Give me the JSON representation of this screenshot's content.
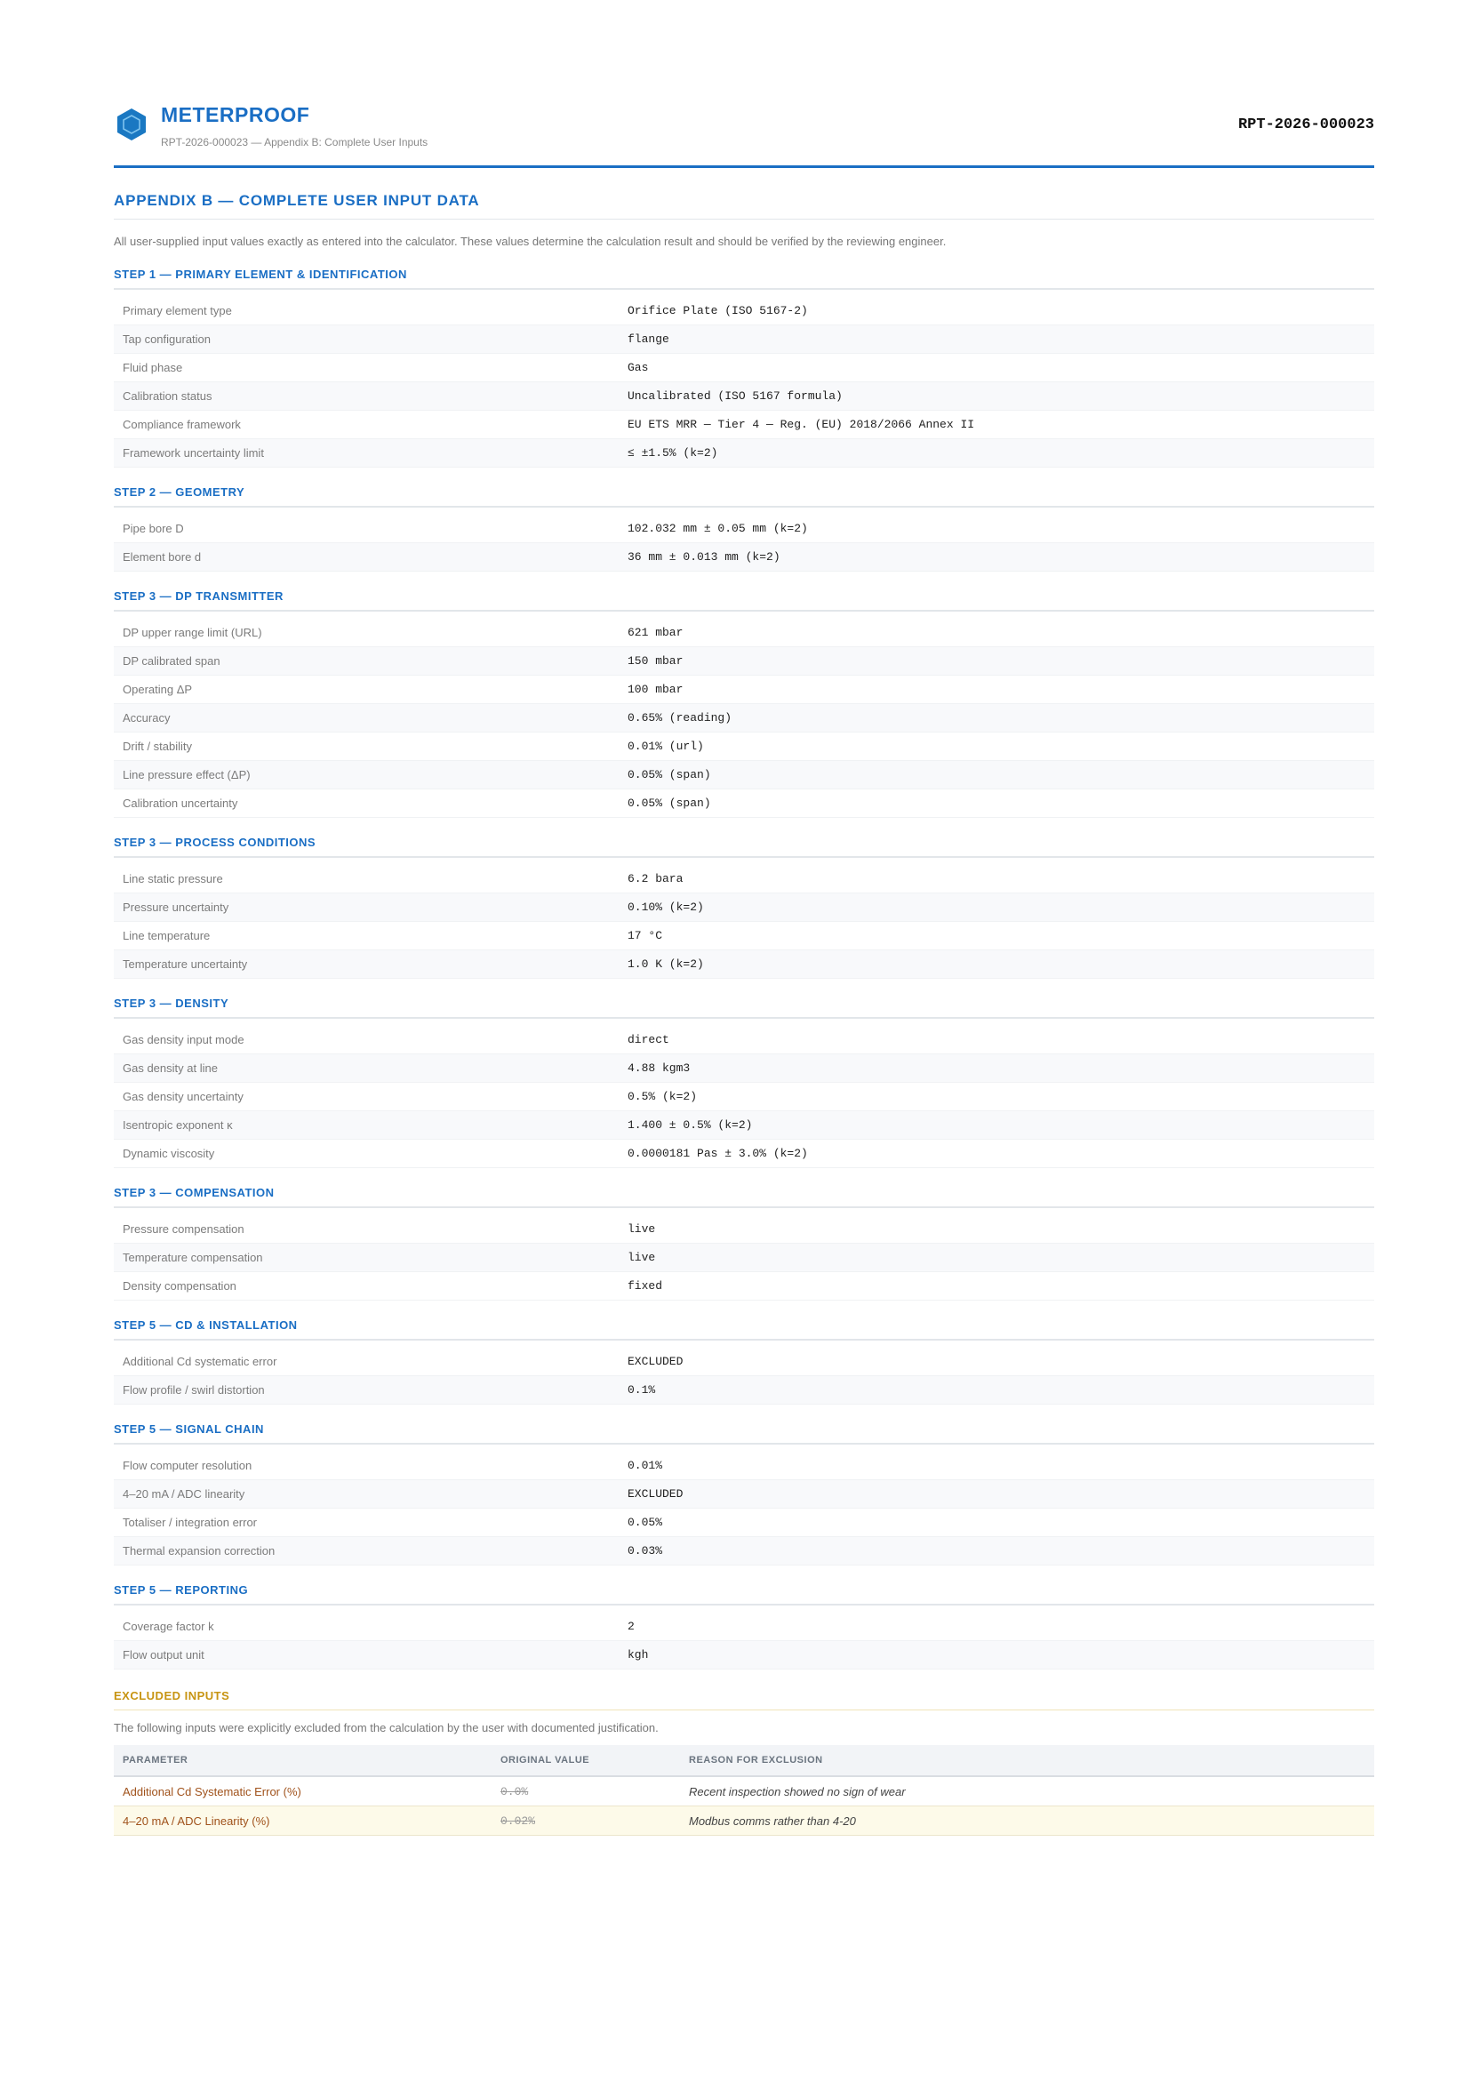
{
  "header": {
    "brand": "METERPROOF",
    "subtitle": "RPT-2026-000023 — Appendix B: Complete User Inputs",
    "report_id": "RPT-2026-000023",
    "accent_color": "#1a6ec4",
    "logo_icon": "hexagon-logo-icon"
  },
  "appendix": {
    "title": "APPENDIX B — COMPLETE USER INPUT DATA",
    "intro": "All user-supplied input values exactly as entered into the calculator. These values determine the calculation result and should be verified by the reviewing engineer."
  },
  "sections": [
    {
      "title": "STEP 1 — PRIMARY ELEMENT & IDENTIFICATION",
      "rows": [
        {
          "label": "Primary element type",
          "value": "Orifice Plate (ISO 5167-2)"
        },
        {
          "label": "Tap configuration",
          "value": "flange"
        },
        {
          "label": "Fluid phase",
          "value": "Gas"
        },
        {
          "label": "Calibration status",
          "value": "Uncalibrated (ISO 5167 formula)"
        },
        {
          "label": "Compliance framework",
          "value": "EU ETS MRR — Tier 4 — Reg. (EU) 2018/2066 Annex II"
        },
        {
          "label": "Framework uncertainty limit",
          "value": "≤ ±1.5% (k=2)"
        }
      ]
    },
    {
      "title": "STEP 2 — GEOMETRY",
      "rows": [
        {
          "label": "Pipe bore D",
          "value": "102.032 mm ± 0.05 mm (k=2)"
        },
        {
          "label": "Element bore d",
          "value": "36 mm ± 0.013 mm (k=2)"
        }
      ]
    },
    {
      "title": "STEP 3 — DP TRANSMITTER",
      "rows": [
        {
          "label": "DP upper range limit (URL)",
          "value": "621 mbar"
        },
        {
          "label": "DP calibrated span",
          "value": "150 mbar"
        },
        {
          "label": "Operating ΔP",
          "value": "100 mbar"
        },
        {
          "label": "Accuracy",
          "value": "0.65% (reading)"
        },
        {
          "label": "Drift / stability",
          "value": "0.01% (url)"
        },
        {
          "label": "Line pressure effect (ΔP)",
          "value": "0.05% (span)"
        },
        {
          "label": "Calibration uncertainty",
          "value": "0.05% (span)"
        }
      ]
    },
    {
      "title": "STEP 3 — PROCESS CONDITIONS",
      "rows": [
        {
          "label": "Line static pressure",
          "value": "6.2 bara"
        },
        {
          "label": "Pressure uncertainty",
          "value": "0.10% (k=2)"
        },
        {
          "label": "Line temperature",
          "value": "17 °C"
        },
        {
          "label": "Temperature uncertainty",
          "value": "1.0 K (k=2)"
        }
      ]
    },
    {
      "title": "STEP 3 — DENSITY",
      "rows": [
        {
          "label": "Gas density input mode",
          "value": "direct"
        },
        {
          "label": "Gas density at line",
          "value": "4.88 kgm3"
        },
        {
          "label": "Gas density uncertainty",
          "value": "0.5% (k=2)"
        },
        {
          "label": "Isentropic exponent κ",
          "value": "1.400 ± 0.5% (k=2)"
        },
        {
          "label": "Dynamic viscosity",
          "value": "0.0000181 Pas ± 3.0% (k=2)"
        }
      ]
    },
    {
      "title": "STEP 3 — COMPENSATION",
      "rows": [
        {
          "label": "Pressure compensation",
          "value": "live"
        },
        {
          "label": "Temperature compensation",
          "value": "live"
        },
        {
          "label": "Density compensation",
          "value": "fixed"
        }
      ]
    },
    {
      "title": "STEP 5 — CD & INSTALLATION",
      "rows": [
        {
          "label": "Additional Cd systematic error",
          "value": "EXCLUDED"
        },
        {
          "label": "Flow profile / swirl distortion",
          "value": "0.1%"
        }
      ]
    },
    {
      "title": "STEP 5 — SIGNAL CHAIN",
      "rows": [
        {
          "label": "Flow computer resolution",
          "value": "0.01%"
        },
        {
          "label": "4–20 mA / ADC linearity",
          "value": "EXCLUDED"
        },
        {
          "label": "Totaliser / integration error",
          "value": "0.05%"
        },
        {
          "label": "Thermal expansion correction",
          "value": "0.03%"
        }
      ]
    },
    {
      "title": "STEP 5 — REPORTING",
      "rows": [
        {
          "label": "Coverage factor k",
          "value": "2"
        },
        {
          "label": "Flow output unit",
          "value": "kgh"
        }
      ]
    }
  ],
  "excluded": {
    "title": "EXCLUDED INPUTS",
    "intro": "The following inputs were explicitly excluded from the calculation by the user with documented justification.",
    "headers": [
      "PARAMETER",
      "ORIGINAL VALUE",
      "REASON FOR EXCLUSION"
    ],
    "rows": [
      {
        "parameter": "Additional Cd Systematic Error (%)",
        "original": "0.0%",
        "reason": "Recent inspection showed no sign of wear"
      },
      {
        "parameter": "4–20 mA / ADC Linearity (%)",
        "original": "0.02%",
        "reason": "Modbus comms rather than 4-20"
      }
    ]
  }
}
